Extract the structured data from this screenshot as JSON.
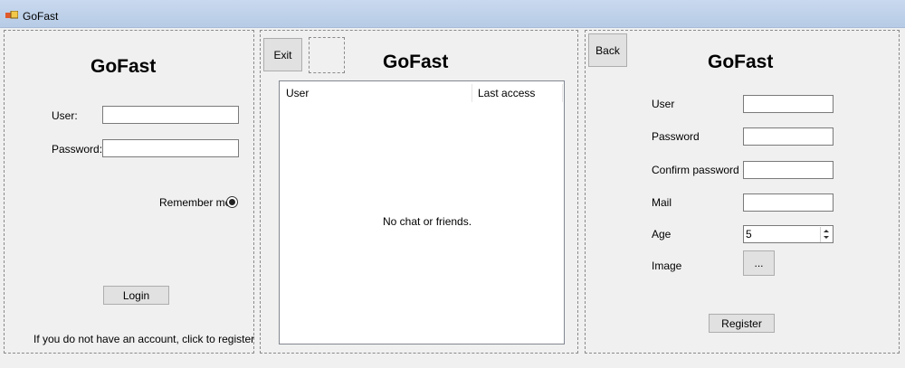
{
  "window": {
    "title": "GoFast"
  },
  "login": {
    "heading": "GoFast",
    "user_label": "User:",
    "user_value": "",
    "password_label": "Password:",
    "password_value": "",
    "remember_label": "Remember me",
    "remember_checked": true,
    "login_button": "Login",
    "register_prompt": "If you do not have an account, click to register"
  },
  "chat": {
    "exit_button": "Exit",
    "heading": "GoFast",
    "columns": [
      "User",
      "Last access"
    ],
    "empty_message": "No chat or friends."
  },
  "register": {
    "back_button": "Back",
    "heading": "GoFast",
    "user_label": "User",
    "password_label": "Password",
    "confirm_label": "Confirm password",
    "mail_label": "Mail",
    "age_label": "Age",
    "age_value": "5",
    "image_label": "Image",
    "browse_button": "...",
    "register_button": "Register"
  }
}
